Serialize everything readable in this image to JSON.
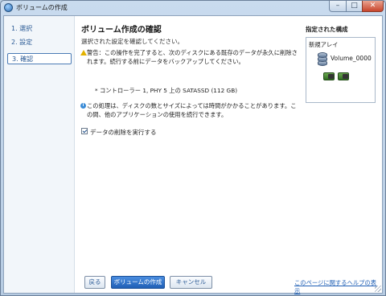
{
  "window": {
    "title": "ボリュームの作成",
    "minimize_label": "–",
    "maximize_label": "□",
    "close_label": "✕"
  },
  "sidebar": {
    "items": [
      {
        "label": "1. 選択"
      },
      {
        "label": "2. 設定"
      },
      {
        "label": "3. 確認",
        "active": true
      }
    ]
  },
  "main": {
    "heading": "ボリューム作成の確認",
    "subtitle": "選択された設定を確認してください。",
    "warning": "警告：この操作を完了すると、次のディスクにある既存のデータが永久に削除されます。続行する前にデータをバックアップしてください。",
    "disk_item": "* コントローラー 1, PHY 5 上の SATASSD (112 GB)",
    "info": "この処理は、ディスクの数とサイズによっては時間がかかることがあります。この間、他のアプリケーションの使用を続行できます。",
    "checkbox": {
      "label": "データの削除を実行する",
      "checked": true
    }
  },
  "right_panel": {
    "title": "指定された構成",
    "array_label": "新規アレイ",
    "volume_label": "Volume_0000"
  },
  "footer": {
    "back_label": "戻る",
    "create_label": "ボリュームの作成",
    "cancel_label": "キャンセル",
    "help_link": "このページに関するヘルプの表示"
  },
  "colors": {
    "accent": "#1f5fb5",
    "warning": "#e3b200",
    "info": "#3a8bd6",
    "disk": "#2f6b22"
  },
  "icons": [
    "app-icon",
    "warning-icon",
    "info-icon",
    "volume-icon",
    "disk-icon"
  ]
}
